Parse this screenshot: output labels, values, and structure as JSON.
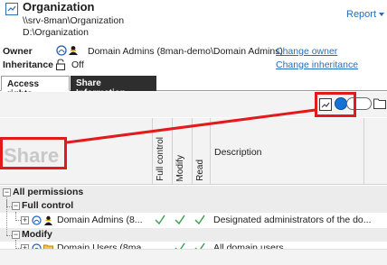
{
  "header": {
    "title": "Organization",
    "path_unc": "\\\\srv-8man\\Organization",
    "path_local": "D:\\Organization",
    "report_label": "Report"
  },
  "owner": {
    "label": "Owner",
    "value": "Domain Admins (8man-demo\\Domain Admins)",
    "change_link": "Change owner"
  },
  "inheritance": {
    "label": "Inheritance",
    "value": "Off",
    "change_link": "Change inheritance"
  },
  "tabs": [
    {
      "label": "Access rights",
      "active": true
    },
    {
      "label": "Share Information",
      "active": false
    }
  ],
  "grid": {
    "share_header": "Share",
    "columns": [
      "Full control",
      "Modify",
      "Read"
    ],
    "description_header": "Description"
  },
  "tree": [
    {
      "label": "All permissions",
      "level": 0,
      "type": "group"
    },
    {
      "label": "Full control",
      "level": 1,
      "type": "group"
    },
    {
      "label": "Domain Admins (8...",
      "level": 2,
      "type": "entry",
      "checks": [
        true,
        true,
        true
      ],
      "description": "Designated administrators of the do..."
    },
    {
      "label": "Modify",
      "level": 1,
      "type": "group"
    },
    {
      "label": "Domain Users (8ma...",
      "level": 2,
      "type": "entry",
      "checks": [
        false,
        true,
        true
      ],
      "description": "All domain users"
    }
  ],
  "colors": {
    "accent": "#1f6fc0",
    "highlight": "#e3191c",
    "check": "#3aa14b"
  }
}
